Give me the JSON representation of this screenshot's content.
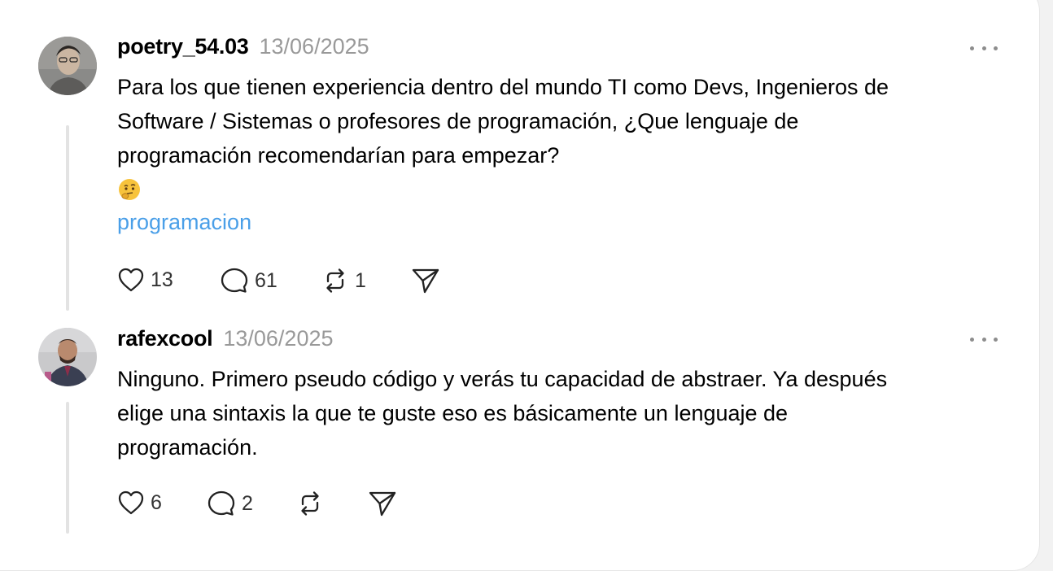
{
  "posts": [
    {
      "username": "poetry_54.03",
      "date": "13/06/2025",
      "text_lines": [
        "Para los que tienen experiencia dentro del mundo TI como Devs, Ingenieros de",
        "Software / Sistemas o profesores de programación, ¿Que lenguaje de",
        "programación recomendarían para empezar?"
      ],
      "emoji": "thinking-face-emoji",
      "tag": "programacion",
      "likes": "13",
      "replies": "61",
      "reposts": "1"
    },
    {
      "username": "rafexcool",
      "date": "13/06/2025",
      "text_lines": [
        "Ninguno. Primero pseudo código y verás tu capacidad de abstraer. Ya después",
        "elige una sintaxis la que te guste eso es básicamente un lenguaje de",
        "programación."
      ],
      "likes": "6",
      "replies": "2",
      "reposts": ""
    }
  ],
  "icons": {
    "like": "heart-icon",
    "reply": "speech-bubble-icon",
    "repost": "repost-arrows-icon",
    "share": "send-paper-plane-icon",
    "more": "more-dots-icon"
  },
  "colors": {
    "tag": "#4a9fe8",
    "date": "#999999",
    "icon": "#222222",
    "thread_line": "#e3e3e3"
  }
}
